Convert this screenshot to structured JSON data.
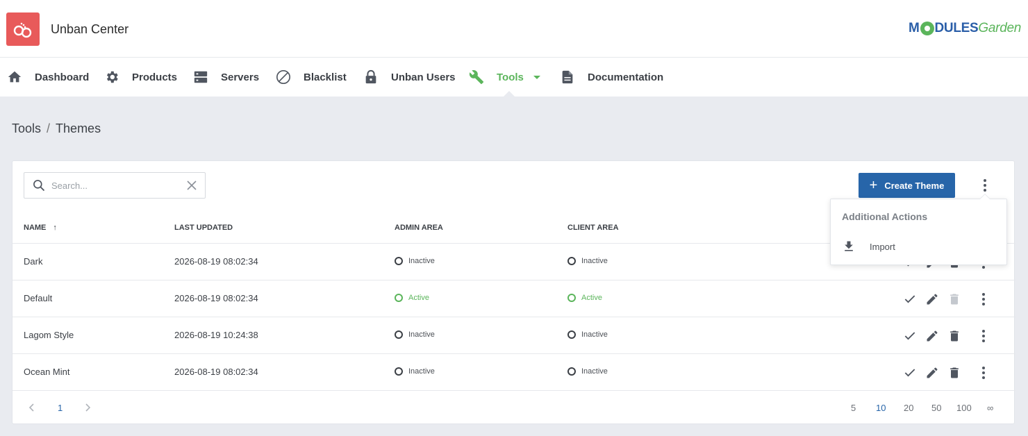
{
  "app": {
    "title": "Unban Center",
    "brand_a": "M",
    "brand_b": "DULES",
    "brand_c": "Garden"
  },
  "nav": {
    "items": [
      {
        "label": "Dashboard",
        "icon": "home-icon"
      },
      {
        "label": "Products",
        "icon": "gear-icon"
      },
      {
        "label": "Servers",
        "icon": "server-icon"
      },
      {
        "label": "Blacklist",
        "icon": "block-icon"
      },
      {
        "label": "Unban Users",
        "icon": "lock-icon"
      },
      {
        "label": "Tools",
        "icon": "wrench-icon",
        "active": true
      },
      {
        "label": "Documentation",
        "icon": "document-icon"
      }
    ]
  },
  "breadcrumb": {
    "parent": "Tools",
    "separator": "/",
    "current": "Themes"
  },
  "toolbar": {
    "search_placeholder": "Search...",
    "create_label": "Create Theme"
  },
  "table": {
    "columns": {
      "name": "NAME",
      "updated": "LAST UPDATED",
      "admin": "ADMIN AREA",
      "client": "CLIENT AREA"
    },
    "sort_indicator": "↑",
    "rows": [
      {
        "name": "Dark",
        "updated": "2026-08-19 08:02:34",
        "admin": "Inactive",
        "client": "Inactive"
      },
      {
        "name": "Default",
        "updated": "2026-08-19 08:02:34",
        "admin": "Active",
        "client": "Active"
      },
      {
        "name": "Lagom Style",
        "updated": "2026-08-19 10:24:38",
        "admin": "Inactive",
        "client": "Inactive"
      },
      {
        "name": "Ocean Mint",
        "updated": "2026-08-19 08:02:34",
        "admin": "Inactive",
        "client": "Inactive"
      }
    ]
  },
  "pagination": {
    "current_page": "1",
    "page_sizes": [
      "5",
      "10",
      "20",
      "50",
      "100",
      "∞"
    ],
    "selected_size": "10"
  },
  "dropdown": {
    "title": "Additional Actions",
    "items": [
      {
        "label": "Import",
        "icon": "download-icon"
      }
    ]
  },
  "colors": {
    "accent": "#2765a9",
    "active": "#5bb55b",
    "logo": "#e85a5a"
  }
}
